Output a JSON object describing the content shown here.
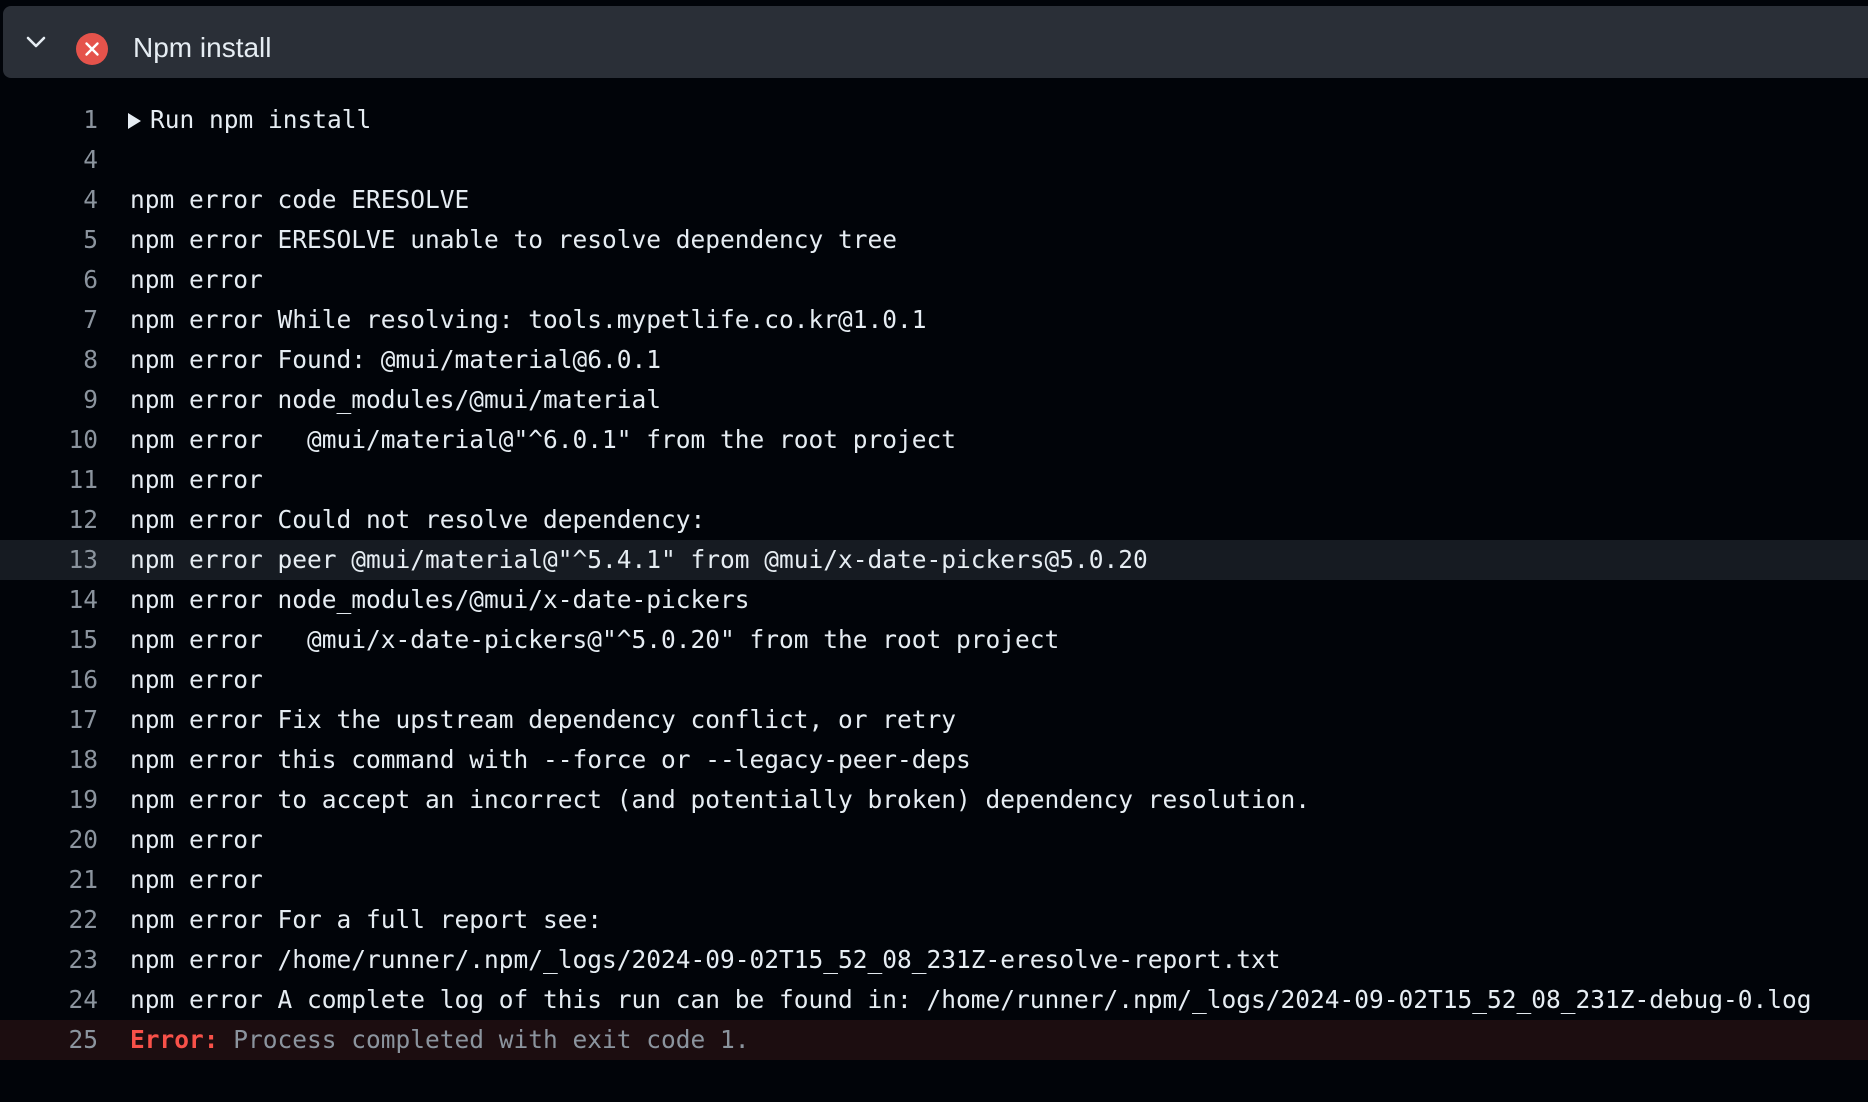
{
  "step": {
    "title": "Npm install",
    "status_icon": "x-circle-icon",
    "status_color": "#e5534b",
    "chevron_icon": "chevron-down-icon"
  },
  "log": {
    "lines": [
      {
        "num": "1",
        "text": "Run npm install",
        "group": true
      },
      {
        "num": "4",
        "text": ""
      },
      {
        "num": "4",
        "text": "npm error code ERESOLVE"
      },
      {
        "num": "5",
        "text": "npm error ERESOLVE unable to resolve dependency tree"
      },
      {
        "num": "6",
        "text": "npm error"
      },
      {
        "num": "7",
        "text": "npm error While resolving: tools.mypetlife.co.kr@1.0.1"
      },
      {
        "num": "8",
        "text": "npm error Found: @mui/material@6.0.1"
      },
      {
        "num": "9",
        "text": "npm error node_modules/@mui/material"
      },
      {
        "num": "10",
        "text": "npm error   @mui/material@\"^6.0.1\" from the root project"
      },
      {
        "num": "11",
        "text": "npm error"
      },
      {
        "num": "12",
        "text": "npm error Could not resolve dependency:"
      },
      {
        "num": "13",
        "text": "npm error peer @mui/material@\"^5.4.1\" from @mui/x-date-pickers@5.0.20",
        "highlight": true
      },
      {
        "num": "14",
        "text": "npm error node_modules/@mui/x-date-pickers"
      },
      {
        "num": "15",
        "text": "npm error   @mui/x-date-pickers@\"^5.0.20\" from the root project"
      },
      {
        "num": "16",
        "text": "npm error"
      },
      {
        "num": "17",
        "text": "npm error Fix the upstream dependency conflict, or retry"
      },
      {
        "num": "18",
        "text": "npm error this command with --force or --legacy-peer-deps"
      },
      {
        "num": "19",
        "text": "npm error to accept an incorrect (and potentially broken) dependency resolution."
      },
      {
        "num": "20",
        "text": "npm error"
      },
      {
        "num": "21",
        "text": "npm error"
      },
      {
        "num": "22",
        "text": "npm error For a full report see:"
      },
      {
        "num": "23",
        "text": "npm error /home/runner/.npm/_logs/2024-09-02T15_52_08_231Z-eresolve-report.txt"
      },
      {
        "num": "24",
        "text": "npm error A complete log of this run can be found in: /home/runner/.npm/_logs/2024-09-02T15_52_08_231Z-debug-0.log"
      }
    ],
    "final": {
      "num": "25",
      "error_label": "Error:",
      "error_message": " Process completed with exit code 1."
    }
  }
}
